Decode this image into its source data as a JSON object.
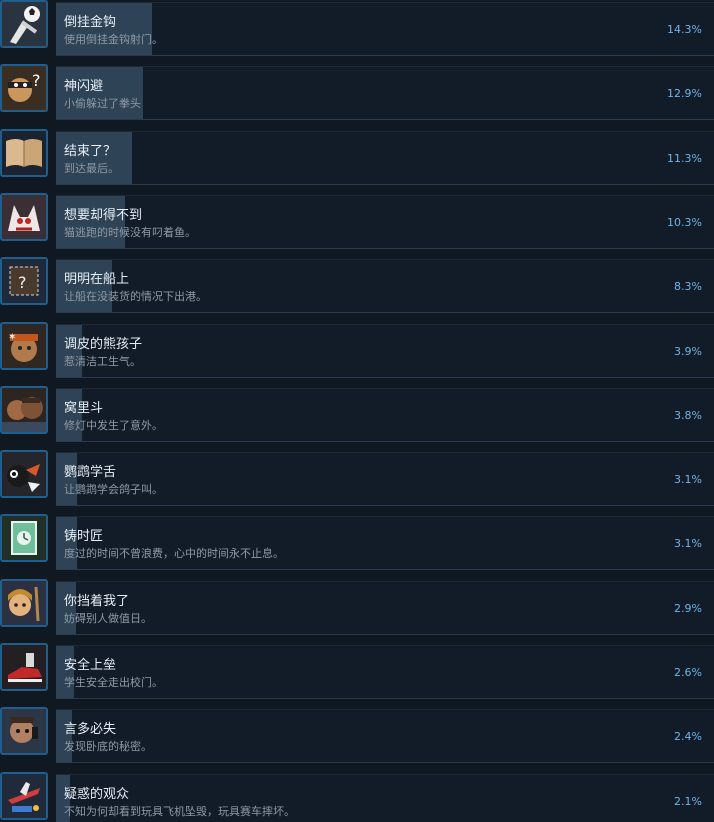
{
  "achievements": [
    {
      "title": "倒挂金钩",
      "desc": "使用倒挂金钩射门。",
      "percent_label": "14.3%",
      "percent": 14.3,
      "icon": "soccer-kick-icon"
    },
    {
      "title": "神闪避",
      "desc": "小偷躲过了拳头",
      "percent_label": "12.9%",
      "percent": 12.9,
      "icon": "thief-question-icon"
    },
    {
      "title": "结束了？",
      "desc": "到达最后。",
      "percent_label": "11.3%",
      "percent": 11.3,
      "icon": "open-book-icon"
    },
    {
      "title": "想要却得不到",
      "desc": "猫逃跑的时候没有叼着鱼。",
      "percent_label": "10.3%",
      "percent": 10.3,
      "icon": "cat-fish-icon"
    },
    {
      "title": "明明在船上",
      "desc": "让船在没装货的情况下出港。",
      "percent_label": "8.3%",
      "percent": 8.3,
      "icon": "ship-box-icon"
    },
    {
      "title": "调皮的熊孩子",
      "desc": "惹清洁工生气。",
      "percent_label": "3.9%",
      "percent": 3.9,
      "icon": "angry-janitor-icon"
    },
    {
      "title": "窝里斗",
      "desc": "修灯中发生了意外。",
      "percent_label": "3.8%",
      "percent": 3.8,
      "icon": "two-men-icon"
    },
    {
      "title": "鹦鹉学舌",
      "desc": "让鹦鹉学会鸽子叫。",
      "percent_label": "3.1%",
      "percent": 3.1,
      "icon": "parrot-icon"
    },
    {
      "title": "铸时匠",
      "desc": "度过的时间不曾浪费，心中的时间永不止息。",
      "percent_label": "3.1%",
      "percent": 3.1,
      "icon": "clock-box-icon"
    },
    {
      "title": "你挡着我了",
      "desc": "妨碍别人做值日。",
      "percent_label": "2.9%",
      "percent": 2.9,
      "icon": "girl-broom-icon"
    },
    {
      "title": "安全上垒",
      "desc": "学生安全走出校门。",
      "percent_label": "2.6%",
      "percent": 2.6,
      "icon": "sneaker-icon"
    },
    {
      "title": "言多必失",
      "desc": "发现卧底的秘密。",
      "percent_label": "2.4%",
      "percent": 2.4,
      "icon": "spy-phone-icon"
    },
    {
      "title": "疑惑的观众",
      "desc": "不知为何却看到玩具飞机坠毁，玩具赛车摔坏。",
      "percent_label": "2.1%",
      "percent": 2.1,
      "icon": "toy-plane-icon"
    }
  ],
  "colors": {
    "background": "#101822",
    "card": "#121c28",
    "bar": "#2f4356",
    "percent_text": "#6fb4e6",
    "icon_border": "#1f5f8f"
  }
}
